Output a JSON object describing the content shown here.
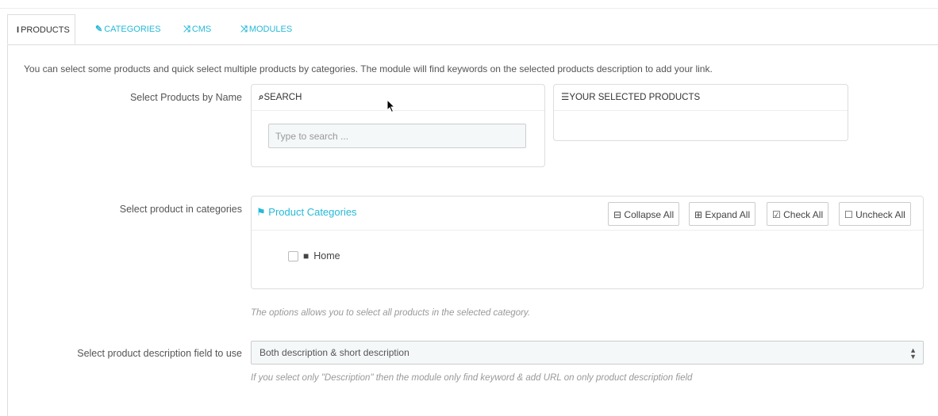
{
  "tabs": [
    {
      "icon": "info-icon",
      "glyph": "i",
      "label": "PRODUCTS",
      "active": true
    },
    {
      "icon": "wrench-icon",
      "glyph": "✎",
      "label": "CATEGORIES",
      "active": false
    },
    {
      "icon": "shuffle-icon",
      "glyph": "⤨",
      "label": "CMS",
      "active": false
    },
    {
      "icon": "shuffle-icon",
      "glyph": "⤨",
      "label": "MODULES",
      "active": false
    }
  ],
  "intro": "You can select some products and quick select multiple products by categories. The module will find keywords on the selected products description to add your link.",
  "search": {
    "label": "Select Products by Name",
    "header": "SEARCH",
    "placeholder": "Type to search ..."
  },
  "selected": {
    "header": "YOUR SELECTED PRODUCTS"
  },
  "categories": {
    "label": "Select product in categories",
    "title": "Product Categories",
    "buttons": {
      "collapse": "Collapse All",
      "expand": "Expand All",
      "check": "Check All",
      "uncheck": "Uncheck All"
    },
    "tree": [
      "Home"
    ],
    "help": "The options allows you to select all products in the selected category."
  },
  "description_field": {
    "label": "Select product description field to use",
    "value": "Both description & short description",
    "help": "If you select only \"Description\" then the module only find keyword & add URL on only product description field"
  },
  "colors": {
    "accent": "#25b9d7",
    "border": "#dddddd",
    "input_bg": "#f5f8f9"
  }
}
